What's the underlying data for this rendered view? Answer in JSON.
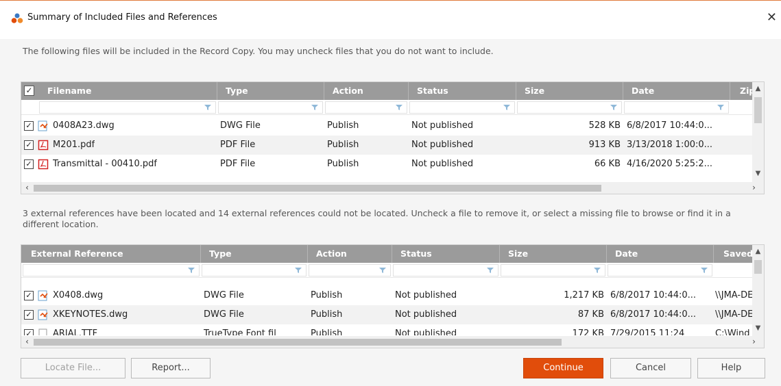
{
  "window": {
    "title": "Summary of Included Files and References"
  },
  "intro_text": "The following files will be included in the Record Copy. You may uncheck files that you do not want to include.",
  "files_grid": {
    "columns": [
      "Filename",
      "Type",
      "Action",
      "Status",
      "Size",
      "Date",
      "Zip"
    ],
    "rows": [
      {
        "checked": true,
        "icon": "dwg-file-icon",
        "filename": "0408A23.dwg",
        "type": "DWG File",
        "action": "Publish",
        "status": "Not published",
        "size": "528 KB",
        "date": "6/8/2017 10:44:0..."
      },
      {
        "checked": true,
        "icon": "pdf-file-icon",
        "filename": "M201.pdf",
        "type": "PDF File",
        "action": "Publish",
        "status": "Not published",
        "size": "913 KB",
        "date": "3/13/2018 1:00:0..."
      },
      {
        "checked": true,
        "icon": "pdf-file-icon",
        "filename": "Transmittal - 00410.pdf",
        "type": "PDF File",
        "action": "Publish",
        "status": "Not published",
        "size": "66 KB",
        "date": "4/16/2020 5:25:2..."
      }
    ]
  },
  "references_text": "3 external references have been located and 14 external references could not be located. Uncheck a file to remove it, or select a missing file to browse or find it in a different location.",
  "refs_grid": {
    "columns": [
      "External Reference",
      "Type",
      "Action",
      "Status",
      "Size",
      "Date",
      "Saved P"
    ],
    "rows": [
      {
        "checked": true,
        "icon": "dwg-file-icon",
        "filename": "X0408.dwg",
        "type": "DWG File",
        "action": "Publish",
        "status": "Not published",
        "size": "1,217 KB",
        "date": "6/8/2017 10:44:0...",
        "saved": "\\\\JMA-DE"
      },
      {
        "checked": true,
        "icon": "dwg-file-icon",
        "filename": "XKEYNOTES.dwg",
        "type": "DWG File",
        "action": "Publish",
        "status": "Not published",
        "size": "87 KB",
        "date": "6/8/2017 10:44:0...",
        "saved": "\\\\JMA-DE"
      },
      {
        "checked": true,
        "icon": "file-icon",
        "filename": "ARIAL.TTF",
        "type": "TrueType Font fil",
        "action": "Publish",
        "status": "Not published",
        "size": "172 KB",
        "date": "7/29/2015 11:24",
        "saved": "C:\\Wind"
      }
    ]
  },
  "buttons": {
    "locate": "Locate File...",
    "report": "Report...",
    "continue": "Continue",
    "cancel": "Cancel",
    "help": "Help"
  },
  "colors": {
    "accent": "#e14d0b",
    "header": "#9b9b9b"
  }
}
